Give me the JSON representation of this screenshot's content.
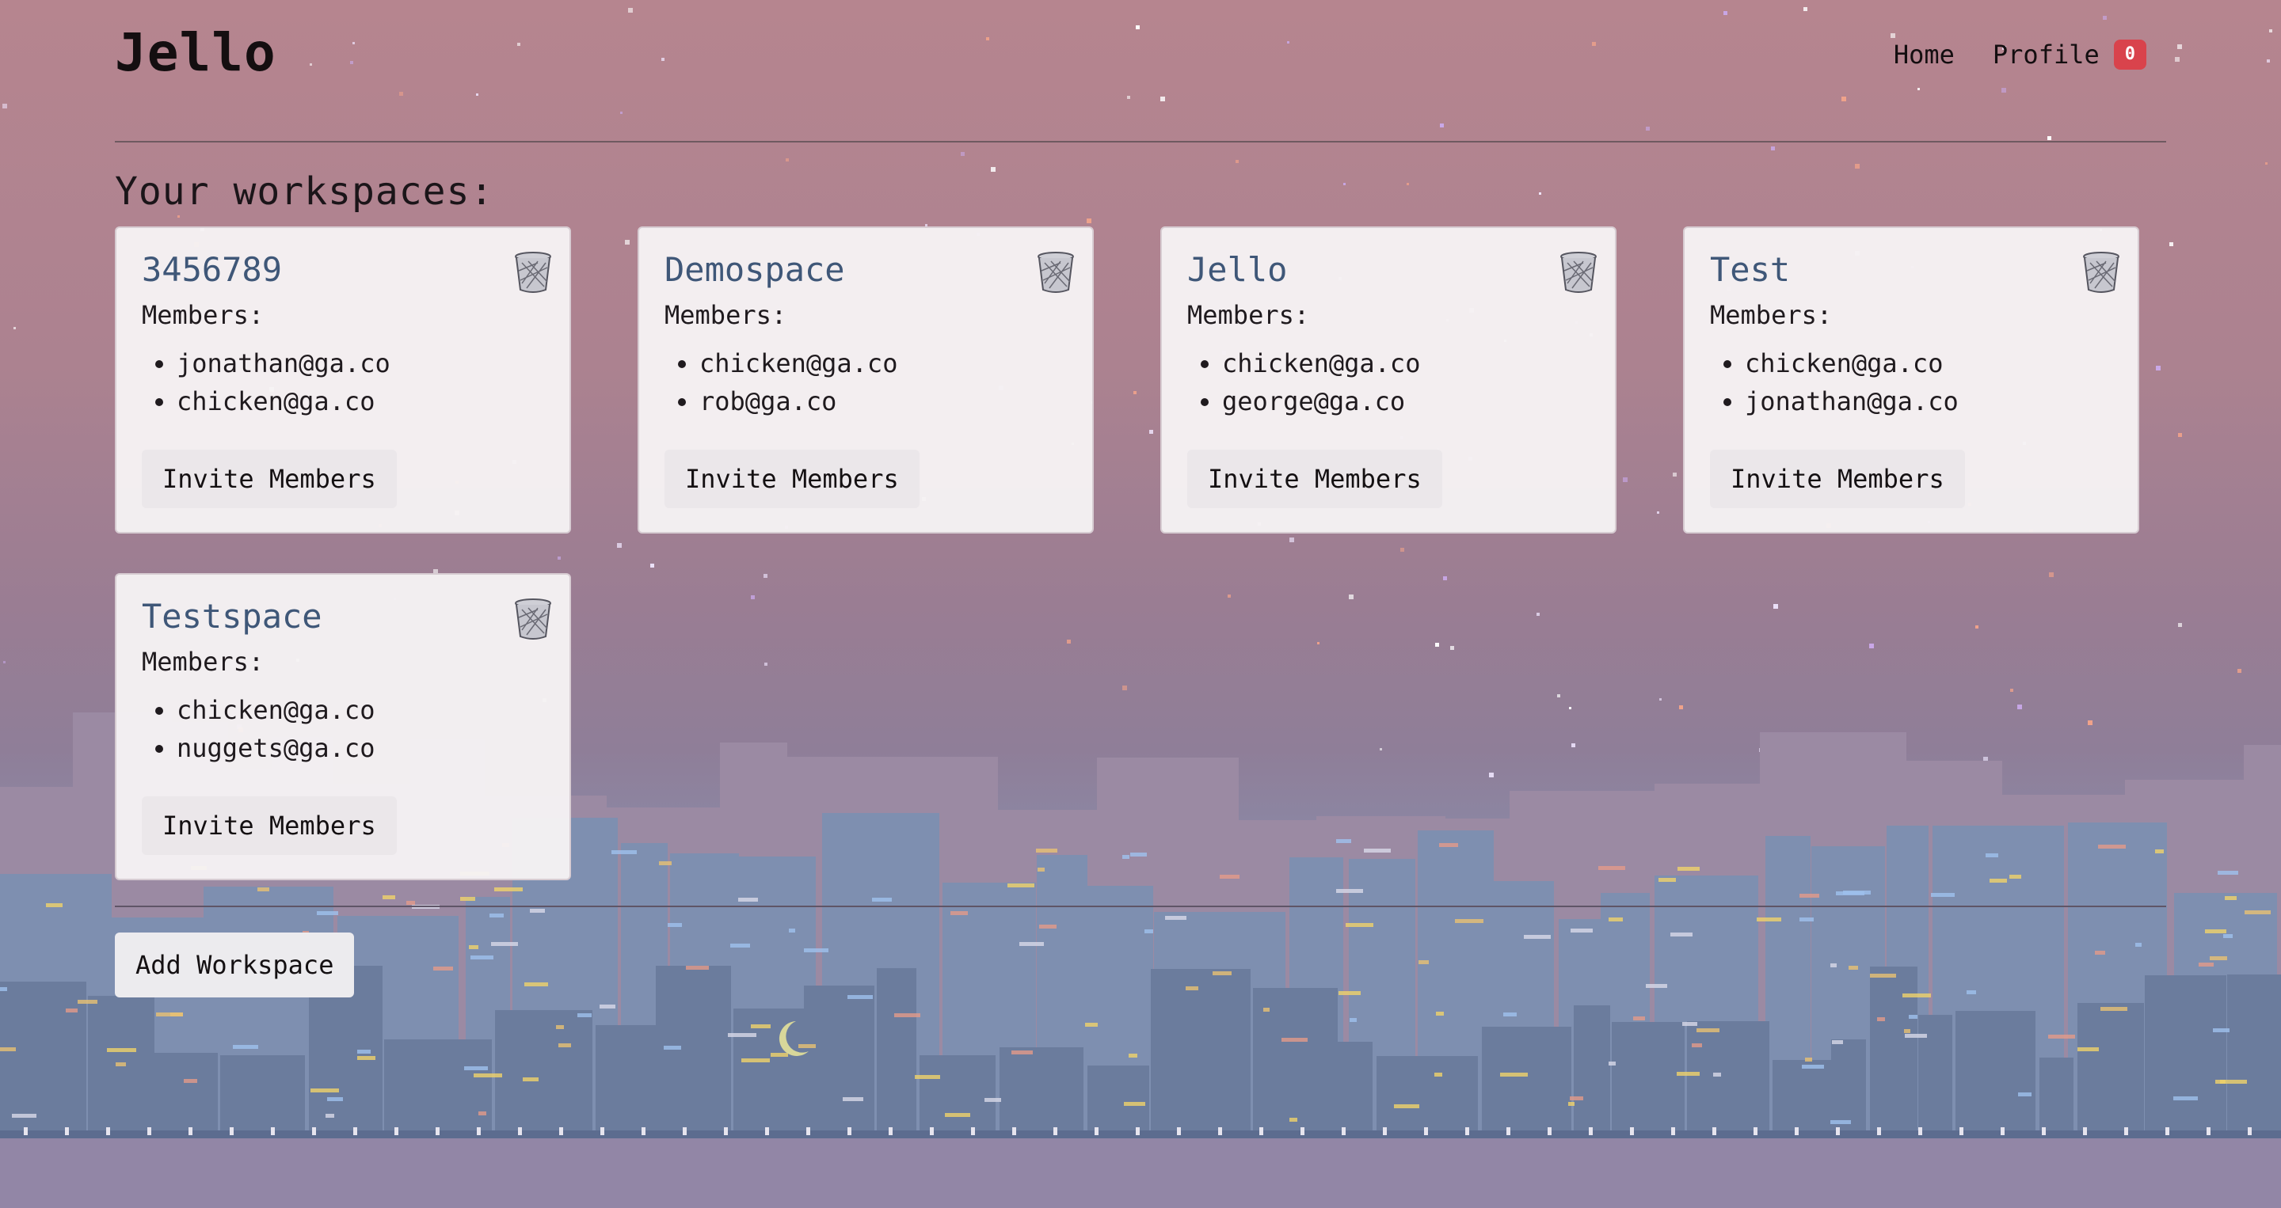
{
  "app": {
    "brand": "Jello"
  },
  "nav": {
    "home_label": "Home",
    "profile_label": "Profile",
    "profile_badge": "0"
  },
  "page": {
    "section_title": "Your workspaces:",
    "members_label": "Members:",
    "invite_label": "Invite Members",
    "add_workspace_label": "Add Workspace"
  },
  "workspaces": [
    {
      "name": "3456789",
      "members": [
        "jonathan@ga.co",
        "chicken@ga.co"
      ]
    },
    {
      "name": "Demospace",
      "members": [
        "chicken@ga.co",
        "rob@ga.co"
      ]
    },
    {
      "name": "Jello",
      "members": [
        "chicken@ga.co",
        "george@ga.co"
      ]
    },
    {
      "name": "Test",
      "members": [
        "chicken@ga.co",
        "jonathan@ga.co"
      ]
    },
    {
      "name": "Testspace",
      "members": [
        "chicken@ga.co",
        "nuggets@ga.co"
      ]
    }
  ],
  "icons": {
    "delete": "trash-icon"
  },
  "colors": {
    "badge": "#d9434c",
    "workspace_title": "#3f5778",
    "card_background": "#f6f3f4",
    "sky_top": "#b6858f",
    "skyline": "#7486a6"
  }
}
